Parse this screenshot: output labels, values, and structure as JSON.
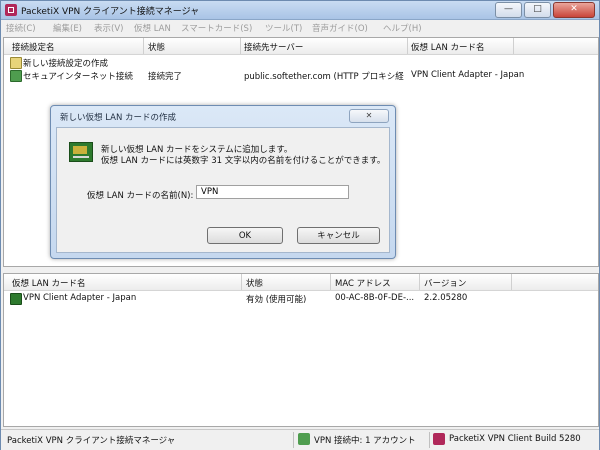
{
  "window": {
    "title": "PacketiX VPN クライアント接続マネージャ",
    "controls": {
      "minimize": "—",
      "maximize": "□",
      "close": "✕"
    }
  },
  "menu": [
    "接続(C)",
    "編集(E)",
    "表示(V)",
    "仮想 LAN",
    "スマートカード(S)",
    "ツール(T)",
    "音声ガイド(O)",
    "ヘルプ(H)"
  ],
  "connections": {
    "headers": [
      "接続設定名",
      "状態",
      "接続先サーバー",
      "仮想 LAN カード名"
    ],
    "rows": [
      {
        "name": "新しい接続設定の作成",
        "status": "",
        "server": "",
        "adapter": ""
      },
      {
        "name": "セキュアインターネット接続",
        "status": "接続完了",
        "server": "public.softether.com (HTTP プロキシ経...",
        "adapter": "VPN Client Adapter - Japan"
      }
    ]
  },
  "adapters": {
    "headers": [
      "仮想 LAN カード名",
      "状態",
      "MAC アドレス",
      "バージョン"
    ],
    "rows": [
      {
        "name": "VPN Client Adapter - Japan",
        "status": "有効 (使用可能)",
        "mac": "00-AC-8B-0F-DE-...",
        "version": "2.2.05280"
      }
    ]
  },
  "dialog": {
    "title": "新しい仮想 LAN カードの作成",
    "close_label": "✕",
    "message_line1": "新しい仮想 LAN カードをシステムに追加します。",
    "message_line2": "仮想 LAN カードには英数字 31 文字以内の名前を付けることができます。",
    "field_label": "仮想 LAN カードの名前(N):",
    "field_value": "VPN",
    "ok_label": "OK",
    "cancel_label": "キャンセル"
  },
  "statusbar": {
    "app_name": "PacketiX VPN クライアント接続マネージャ",
    "connections": "VPN 接続中: 1 アカウント",
    "build": "PacketiX VPN Client Build 5280"
  },
  "colors": {
    "accent": "#b0285a",
    "title_bar": "#a9c4e6",
    "adapter_icon": "#2e7a2e"
  }
}
